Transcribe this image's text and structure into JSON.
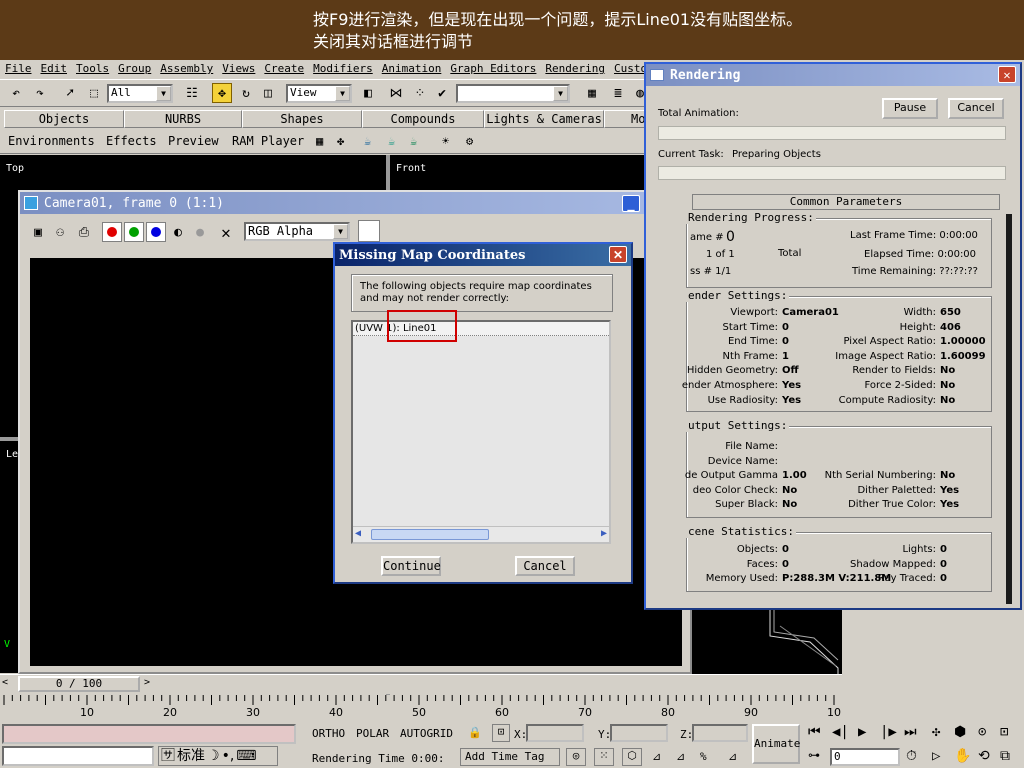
{
  "banner": {
    "line1": "按F9进行渲染，但是现在出现一个问题，提示Line01没有贴图坐标。",
    "line2": "关闭其对话框进行调节"
  },
  "menu": {
    "items": [
      "File",
      "Edit",
      "Tools",
      "Group",
      "Assembly",
      "Views",
      "Create",
      "Modifiers",
      "Animation",
      "Graph Editors",
      "Rendering",
      "Customi"
    ]
  },
  "toolbar": {
    "selection_filter": "All",
    "ref_coord": "View",
    "named_selection": ""
  },
  "tabs": {
    "row1": [
      "Objects",
      "NURBS",
      "Shapes",
      "Compounds",
      "Lights & Cameras",
      "Mo"
    ],
    "row2": [
      "Environments",
      "Effects",
      "Preview",
      "RAM Player"
    ]
  },
  "viewports": {
    "top_label": "Top",
    "front_label": "Front",
    "left_label": "Le",
    "persp_label": "V"
  },
  "framewin": {
    "title": "Camera01, frame 0 (1:1)",
    "channel": "RGB Alpha",
    "colors": {
      "red": "#e00000",
      "green": "#00a000",
      "blue": "#0000e0"
    }
  },
  "missing": {
    "title": "Missing Map Coordinates",
    "message": "The following objects require map coordinates and may not render correctly:",
    "list_item": "(UVW 1): Line01",
    "continue_label": "Continue",
    "cancel_label": "Cancel"
  },
  "rendering": {
    "title": "Rendering",
    "total_animation_label": "Total Animation:",
    "pause_label": "Pause",
    "cancel_label": "Cancel",
    "current_task_label": "Current Task:",
    "current_task_value": "Preparing Objects",
    "common_params": "Common Parameters",
    "progress": {
      "title": "Rendering Progress:",
      "frame_label": "ame #",
      "frame_value": "0",
      "of_label": "1 of 1",
      "total_label": "Total",
      "pass_label": "ss # 1/1",
      "last_frame_time": "Last Frame Time:  0:00:00",
      "elapsed_time": "Elapsed Time:  0:00:00",
      "time_remaining": "Time Remaining:  ??:??:??"
    },
    "render_settings": {
      "title": "ender Settings:",
      "left": [
        {
          "k": "Viewport:",
          "v": "Camera01"
        },
        {
          "k": "Start Time:",
          "v": "0"
        },
        {
          "k": "End Time:",
          "v": "0"
        },
        {
          "k": "Nth Frame:",
          "v": "1"
        },
        {
          "k": "Hidden Geometry:",
          "v": "Off"
        },
        {
          "k": "ender Atmosphere:",
          "v": "Yes"
        },
        {
          "k": "Use Radiosity:",
          "v": "Yes"
        }
      ],
      "right": [
        {
          "k": "Width:",
          "v": "650"
        },
        {
          "k": "Height:",
          "v": "406"
        },
        {
          "k": "Pixel Aspect Ratio:",
          "v": "1.00000"
        },
        {
          "k": "Image Aspect Ratio:",
          "v": "1.60099"
        },
        {
          "k": "Render to Fields:",
          "v": "No"
        },
        {
          "k": "Force 2-Sided:",
          "v": "No"
        },
        {
          "k": "Compute Radiosity:",
          "v": "No"
        }
      ]
    },
    "output_settings": {
      "title": "utput Settings:",
      "left": [
        {
          "k": "File Name:",
          "v": ""
        },
        {
          "k": "Device Name:",
          "v": ""
        },
        {
          "k": "de Output Gamma",
          "v": "1.00"
        },
        {
          "k": "deo Color Check:",
          "v": "No"
        },
        {
          "k": "Super Black:",
          "v": "No"
        }
      ],
      "right": [
        {
          "k": "",
          "v": ""
        },
        {
          "k": "",
          "v": ""
        },
        {
          "k": "Nth Serial Numbering:",
          "v": "No"
        },
        {
          "k": "Dither Paletted:",
          "v": "Yes"
        },
        {
          "k": "Dither True Color:",
          "v": "Yes"
        }
      ]
    },
    "scene_stats": {
      "title": "cene Statistics:",
      "left": [
        {
          "k": "Objects:",
          "v": "0"
        },
        {
          "k": "Faces:",
          "v": "0"
        },
        {
          "k": "Memory Used:",
          "v": "P:288.3M V:211.8M"
        }
      ],
      "right": [
        {
          "k": "Lights:",
          "v": "0"
        },
        {
          "k": "Shadow Mapped:",
          "v": "0"
        },
        {
          "k": "Ray Traced:",
          "v": "0"
        }
      ]
    }
  },
  "timeline": {
    "slider_label": "0 / 100",
    "ruler_ticks": [
      "10",
      "20",
      "30",
      "40",
      "50",
      "60",
      "70",
      "80",
      "90",
      "10"
    ]
  },
  "status": {
    "ortho": "ORTHO",
    "polar": "POLAR",
    "autogrid": "AUTOGRID",
    "x_label": "X:",
    "y_label": "Y:",
    "z_label": "Z:",
    "rendering_time": "Rendering Time  0:00:",
    "add_time_tag": "Add Time Tag",
    "animate": "Animate",
    "frame_value": "0",
    "ime_label": "标准"
  }
}
